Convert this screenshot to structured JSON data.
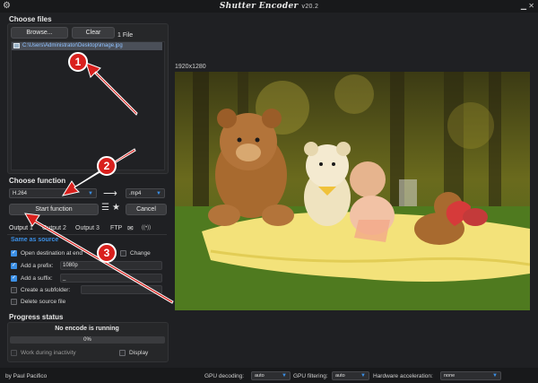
{
  "app": {
    "title": "Shutter Encoder",
    "version": "v20.2"
  },
  "choose_files": {
    "title": "Choose files",
    "browse_label": "Browse...",
    "clear_label": "Clear",
    "file_count": "1 File",
    "files": [
      "C:\\Users\\Administrator\\Desktop\\image.jpg"
    ]
  },
  "choose_function": {
    "title": "Choose function",
    "function_value": "H.264",
    "extension_value": ".mp4",
    "start_label": "Start function",
    "cancel_label": "Cancel"
  },
  "output": {
    "tabs": [
      "Output 1",
      "Output 2",
      "Output 3",
      "FTP"
    ],
    "same_as_source": "Same as source",
    "open_destination_label": "Open destination at end",
    "change_label": "Change",
    "add_prefix_label": "Add a prefix:",
    "prefix_value": "1080p",
    "add_suffix_label": "Add a suffix:",
    "suffix_value": "_",
    "create_subfolder_label": "Create a subfolder:",
    "delete_source_label": "Delete source file"
  },
  "progress": {
    "title": "Progress status",
    "status_text": "No encode is running",
    "percent_text": "0%",
    "percent_value": 0,
    "work_inactivity_label": "Work during inactivity",
    "display_label": "Display"
  },
  "preview": {
    "resolution": "1920x1280"
  },
  "statusbar": {
    "author": "by Paul Pacifico",
    "gpu_decoding_label": "GPU decoding:",
    "gpu_decoding_value": "auto",
    "gpu_filtering_label": "GPU filtering:",
    "gpu_filtering_value": "auto",
    "hw_accel_label": "Hardware acceleration:",
    "hw_accel_value": "none"
  },
  "annotations": {
    "markers": [
      "1",
      "2",
      "3"
    ],
    "marker_color": "#d9201d"
  },
  "colors": {
    "accent": "#3b8fe5",
    "background": "#1f2023"
  }
}
